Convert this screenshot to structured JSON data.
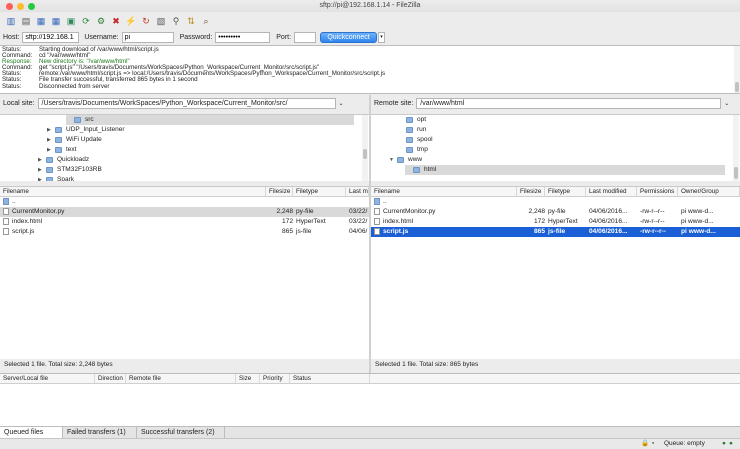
{
  "window": {
    "title": "sftp://pi@192.168.1.14 - FileZilla"
  },
  "quickconnect": {
    "host_label": "Host:",
    "host_value": "sftp://192.168.1",
    "username_label": "Username:",
    "username_value": "pi",
    "password_label": "Password:",
    "password_value": "•••••••••",
    "port_label": "Port:",
    "port_value": "",
    "button_label": "Quickconnect"
  },
  "log": [
    {
      "type": "Status:",
      "text": "Starting download of /var/www/html/script.js",
      "color": "#222222"
    },
    {
      "type": "Command:",
      "text": "cd \"/var/www/html\"",
      "color": "#222222"
    },
    {
      "type": "Response:",
      "text": "New directory is: \"/var/www/html\"",
      "color": "#1a7a1a"
    },
    {
      "type": "Command:",
      "text": "get \"script.js\" \"/Users/travis/Documents/WorkSpaces/Python_Workspace/Current_Monitor/src/script.js\"",
      "color": "#222222"
    },
    {
      "type": "Status:",
      "text": "remote:/var/www/html/script.js => local:/Users/travis/Documents/WorkSpaces/Python_Workspace/Current_Monitor/src/script.js",
      "color": "#222222"
    },
    {
      "type": "Status:",
      "text": "File transfer successful, transferred 865 bytes in 1 second",
      "color": "#222222"
    },
    {
      "type": "Status:",
      "text": "Disconnected from server",
      "color": "#222222"
    }
  ],
  "local": {
    "site_label": "Local site:",
    "path": "/Users/travis/Documents/WorkSpaces/Python_Workspace/Current_Monitor/src/",
    "tree": [
      {
        "label": "src",
        "expander": "",
        "selected": true
      },
      {
        "label": "UDP_Input_Listener",
        "expander": "▶"
      },
      {
        "label": "WiFi Update",
        "expander": "▶"
      },
      {
        "label": "text",
        "expander": "▶"
      },
      {
        "label": "Quickloadz",
        "expander": "▶"
      },
      {
        "label": "STM32F103RB",
        "expander": "▶"
      },
      {
        "label": "Spark",
        "expander": "▶"
      }
    ],
    "columns": [
      "Filename",
      "Filesize",
      "Filetype",
      "Last mo"
    ],
    "files": [
      {
        "name": "..",
        "size": "",
        "type": "",
        "modified": "",
        "icon": "parent-folder-icon"
      },
      {
        "name": "CurrentMonitor.py",
        "size": "2,248",
        "type": "py-file",
        "modified": "03/22/",
        "highlight": true
      },
      {
        "name": "index.html",
        "size": "172",
        "type": "HyperText",
        "modified": "03/22/"
      },
      {
        "name": "script.js",
        "size": "865",
        "type": "js-file",
        "modified": "04/06/"
      }
    ],
    "status": "Selected 1 file. Total size: 2,248 bytes"
  },
  "remote": {
    "site_label": "Remote site:",
    "path": "/var/www/html",
    "tree": [
      {
        "label": "opt",
        "expander": ""
      },
      {
        "label": "run",
        "expander": ""
      },
      {
        "label": "spool",
        "expander": ""
      },
      {
        "label": "tmp",
        "expander": ""
      },
      {
        "label": "www",
        "expander": "▼"
      },
      {
        "label": "html",
        "expander": "",
        "selected": true
      }
    ],
    "columns": [
      "Filename",
      "Filesize",
      "Filetype",
      "Last modified",
      "Permissions",
      "Owner/Group"
    ],
    "files": [
      {
        "name": "..",
        "size": "",
        "type": "",
        "modified": "",
        "perms": "",
        "owner": "",
        "icon": "parent-folder-icon"
      },
      {
        "name": "CurrentMonitor.py",
        "size": "2,248",
        "type": "py-file",
        "modified": "04/06/2016...",
        "perms": "-rw-r--r--",
        "owner": "pi www-d..."
      },
      {
        "name": "index.html",
        "size": "172",
        "type": "HyperText",
        "modified": "04/06/2016...",
        "perms": "-rw-r--r--",
        "owner": "pi www-d..."
      },
      {
        "name": "script.js",
        "size": "865",
        "type": "js-file",
        "modified": "04/06/2016...",
        "perms": "-rw-r--r--",
        "owner": "pi www-d...",
        "selected": true
      }
    ],
    "status": "Selected 1 file. Total size: 865 bytes"
  },
  "queue": {
    "columns": [
      "Server/Local file",
      "Direction",
      "Remote file",
      "Size",
      "Priority",
      "Status"
    ]
  },
  "tabs": [
    "Queued files",
    "Failed transfers (1)",
    "Successful transfers (2)"
  ],
  "statusbar": {
    "queue": "Queue: empty"
  },
  "colors": {
    "selection": "#1a5fd6",
    "highlight": "#d9d9d9",
    "accent": "#2f85ef"
  }
}
